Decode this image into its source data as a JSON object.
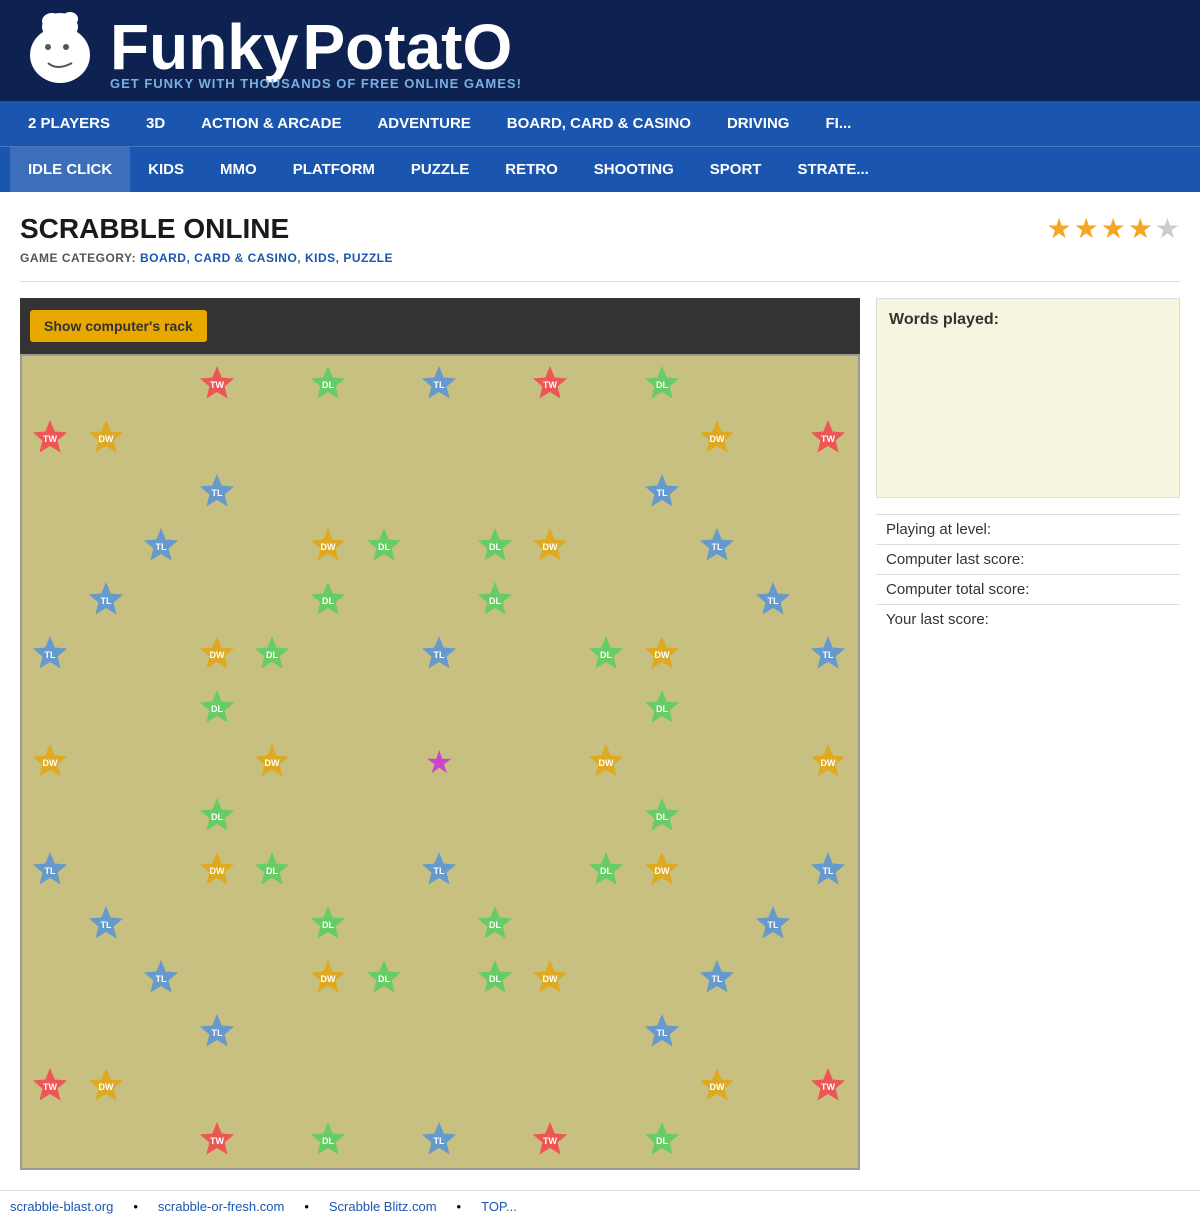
{
  "site": {
    "name_funky": "Funky",
    "name_potato": "PotatO",
    "tagline": "GET FUNKY WITH THOUSANDS OF FREE ONLINE GAMES!"
  },
  "nav_primary": {
    "items": [
      {
        "label": "2 PLAYERS",
        "href": "#"
      },
      {
        "label": "3D",
        "href": "#"
      },
      {
        "label": "ACTION & ARCADE",
        "href": "#"
      },
      {
        "label": "ADVENTURE",
        "href": "#"
      },
      {
        "label": "BOARD, CARD & CASINO",
        "href": "#"
      },
      {
        "label": "DRIVING",
        "href": "#"
      },
      {
        "label": "FI...",
        "href": "#"
      }
    ]
  },
  "nav_secondary": {
    "items": [
      {
        "label": "IDLE CLICK",
        "href": "#",
        "active": true
      },
      {
        "label": "KIDS",
        "href": "#"
      },
      {
        "label": "MMO",
        "href": "#"
      },
      {
        "label": "PLATFORM",
        "href": "#"
      },
      {
        "label": "PUZZLE",
        "href": "#"
      },
      {
        "label": "RETRO",
        "href": "#"
      },
      {
        "label": "SHOOTING",
        "href": "#"
      },
      {
        "label": "SPORT",
        "href": "#"
      },
      {
        "label": "STRATE...",
        "href": "#"
      }
    ]
  },
  "game": {
    "title": "SCRABBLE ONLINE",
    "category_label": "GAME CATEGORY:",
    "categories": "BOARD, CARD & CASINO, KIDS, PUZZLE",
    "rating_filled": 4,
    "rating_empty": 1
  },
  "board_controls": {
    "show_rack_label": "Show computer's rack"
  },
  "sidebar": {
    "words_played_label": "Words played:",
    "playing_level_label": "Playing at level:",
    "computer_last_label": "Computer last score:",
    "computer_total_label": "Computer total score:",
    "your_last_label": "Your last score:"
  },
  "bottom_links": [
    {
      "label": "scrabble-blast.org",
      "href": "#"
    },
    {
      "label": "scrabble-or-fresh.com",
      "href": "#"
    },
    {
      "label": "Scrabble Blitz.com",
      "href": "#"
    },
    {
      "label": "TOP...",
      "href": "#"
    }
  ],
  "board": {
    "rows": 15,
    "cols": 15,
    "specials": [
      {
        "r": 0,
        "c": 3,
        "type": "tw"
      },
      {
        "r": 0,
        "c": 5,
        "type": "dl"
      },
      {
        "r": 0,
        "c": 7,
        "type": "tl"
      },
      {
        "r": 0,
        "c": 9,
        "type": "tw"
      },
      {
        "r": 0,
        "c": 11,
        "type": "dl"
      },
      {
        "r": 1,
        "c": 0,
        "type": "tw"
      },
      {
        "r": 1,
        "c": 1,
        "type": "dw"
      },
      {
        "r": 1,
        "c": 12,
        "type": "dw"
      },
      {
        "r": 1,
        "c": 14,
        "type": "tw"
      },
      {
        "r": 2,
        "c": 3,
        "type": "tl"
      },
      {
        "r": 2,
        "c": 11,
        "type": "tl"
      },
      {
        "r": 3,
        "c": 2,
        "type": "tl"
      },
      {
        "r": 3,
        "c": 5,
        "type": "dw"
      },
      {
        "r": 3,
        "c": 6,
        "type": "dl"
      },
      {
        "r": 3,
        "c": 8,
        "type": "dl"
      },
      {
        "r": 3,
        "c": 9,
        "type": "dw"
      },
      {
        "r": 3,
        "c": 12,
        "type": "tl"
      },
      {
        "r": 4,
        "c": 1,
        "type": "tl"
      },
      {
        "r": 4,
        "c": 5,
        "type": "dl"
      },
      {
        "r": 4,
        "c": 8,
        "type": "dl"
      },
      {
        "r": 4,
        "c": 13,
        "type": "tl"
      },
      {
        "r": 5,
        "c": 0,
        "type": "tl"
      },
      {
        "r": 5,
        "c": 3,
        "type": "dw"
      },
      {
        "r": 5,
        "c": 4,
        "type": "dl"
      },
      {
        "r": 5,
        "c": 7,
        "type": "tl"
      },
      {
        "r": 5,
        "c": 10,
        "type": "dl"
      },
      {
        "r": 5,
        "c": 11,
        "type": "dw"
      },
      {
        "r": 5,
        "c": 14,
        "type": "tl"
      },
      {
        "r": 6,
        "c": 3,
        "type": "dl"
      },
      {
        "r": 6,
        "c": 11,
        "type": "dl"
      },
      {
        "r": 7,
        "c": 0,
        "type": "dw"
      },
      {
        "r": 7,
        "c": 4,
        "type": "dw"
      },
      {
        "r": 7,
        "c": 7,
        "type": "center"
      },
      {
        "r": 7,
        "c": 10,
        "type": "dw"
      },
      {
        "r": 7,
        "c": 14,
        "type": "dw"
      },
      {
        "r": 8,
        "c": 3,
        "type": "dl"
      },
      {
        "r": 8,
        "c": 11,
        "type": "dl"
      },
      {
        "r": 9,
        "c": 0,
        "type": "tl"
      },
      {
        "r": 9,
        "c": 3,
        "type": "dw"
      },
      {
        "r": 9,
        "c": 4,
        "type": "dl"
      },
      {
        "r": 9,
        "c": 7,
        "type": "tl"
      },
      {
        "r": 9,
        "c": 10,
        "type": "dl"
      },
      {
        "r": 9,
        "c": 11,
        "type": "dw"
      },
      {
        "r": 9,
        "c": 14,
        "type": "tl"
      },
      {
        "r": 10,
        "c": 1,
        "type": "tl"
      },
      {
        "r": 10,
        "c": 5,
        "type": "dl"
      },
      {
        "r": 10,
        "c": 8,
        "type": "dl"
      },
      {
        "r": 10,
        "c": 13,
        "type": "tl"
      },
      {
        "r": 11,
        "c": 2,
        "type": "tl"
      },
      {
        "r": 11,
        "c": 5,
        "type": "dw"
      },
      {
        "r": 11,
        "c": 6,
        "type": "dl"
      },
      {
        "r": 11,
        "c": 8,
        "type": "dl"
      },
      {
        "r": 11,
        "c": 9,
        "type": "dw"
      },
      {
        "r": 11,
        "c": 12,
        "type": "tl"
      },
      {
        "r": 12,
        "c": 3,
        "type": "tl"
      },
      {
        "r": 12,
        "c": 11,
        "type": "tl"
      },
      {
        "r": 13,
        "c": 0,
        "type": "tw"
      },
      {
        "r": 13,
        "c": 1,
        "type": "dw"
      },
      {
        "r": 13,
        "c": 12,
        "type": "dw"
      },
      {
        "r": 13,
        "c": 14,
        "type": "tw"
      },
      {
        "r": 14,
        "c": 3,
        "type": "tw"
      },
      {
        "r": 14,
        "c": 5,
        "type": "dl"
      },
      {
        "r": 14,
        "c": 7,
        "type": "tl"
      },
      {
        "r": 14,
        "c": 9,
        "type": "tw"
      },
      {
        "r": 14,
        "c": 11,
        "type": "dl"
      }
    ]
  }
}
